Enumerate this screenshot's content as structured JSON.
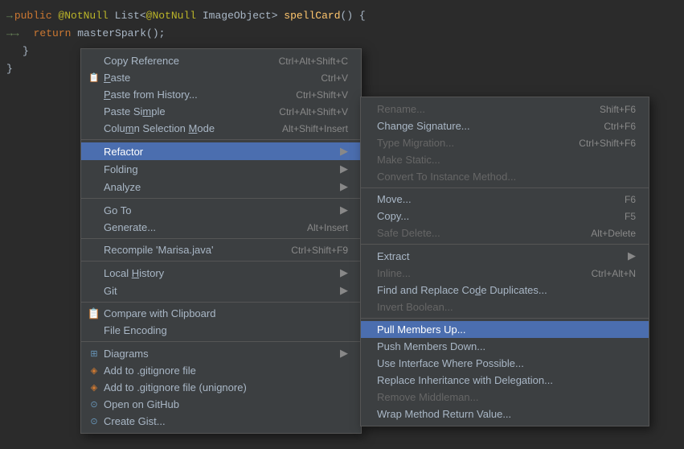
{
  "code": {
    "lines": [
      {
        "id": "line1",
        "arrow": "→",
        "content": "public ",
        "annotation": "@NotNull",
        "rest": " List<",
        "ann2": "@NotNull",
        "rest2": " ImageObject> ",
        "fn": "spellCard",
        "end": "() {"
      },
      {
        "id": "line2",
        "arrow": "→→",
        "indent": true,
        "ret": "return ",
        "text": "masterSpark();"
      },
      {
        "id": "line3",
        "brace": "}"
      }
    ]
  },
  "leftMenu": {
    "items": [
      {
        "id": "copy-reference",
        "label": "Copy Reference",
        "shortcut": "Ctrl+Alt+Shift+C",
        "icon": "",
        "hasArrow": false
      },
      {
        "id": "paste",
        "label": "Paste",
        "shortcut": "Ctrl+V",
        "icon": "📋",
        "hasArrow": false
      },
      {
        "id": "paste-from-history",
        "label": "Paste from History...",
        "shortcut": "Ctrl+Shift+V",
        "icon": "",
        "hasArrow": false
      },
      {
        "id": "paste-simple",
        "label": "Paste Simple",
        "shortcut": "Ctrl+Alt+Shift+V",
        "icon": "",
        "hasArrow": false
      },
      {
        "id": "column-selection",
        "label": "Column Selection Mode",
        "shortcut": "Alt+Shift+Insert",
        "icon": "",
        "hasArrow": false
      },
      {
        "id": "separator1",
        "type": "separator"
      },
      {
        "id": "refactor",
        "label": "Refactor",
        "shortcut": "",
        "icon": "",
        "hasArrow": true,
        "active": true
      },
      {
        "id": "folding",
        "label": "Folding",
        "shortcut": "",
        "icon": "",
        "hasArrow": true
      },
      {
        "id": "analyze",
        "label": "Analyze",
        "shortcut": "",
        "icon": "",
        "hasArrow": true
      },
      {
        "id": "separator2",
        "type": "separator"
      },
      {
        "id": "goto",
        "label": "Go To",
        "shortcut": "",
        "icon": "",
        "hasArrow": true
      },
      {
        "id": "generate",
        "label": "Generate...",
        "shortcut": "Alt+Insert",
        "icon": "",
        "hasArrow": false
      },
      {
        "id": "separator3",
        "type": "separator"
      },
      {
        "id": "recompile",
        "label": "Recompile 'Marisa.java'",
        "shortcut": "Ctrl+Shift+F9",
        "icon": "",
        "hasArrow": false
      },
      {
        "id": "separator4",
        "type": "separator"
      },
      {
        "id": "local-history",
        "label": "Local History",
        "shortcut": "",
        "icon": "",
        "hasArrow": true
      },
      {
        "id": "git",
        "label": "Git",
        "shortcut": "",
        "icon": "",
        "hasArrow": true
      },
      {
        "id": "separator5",
        "type": "separator"
      },
      {
        "id": "compare-clipboard",
        "label": "Compare with Clipboard",
        "shortcut": "",
        "icon": "📋",
        "hasArrow": false
      },
      {
        "id": "file-encoding",
        "label": "File Encoding",
        "shortcut": "",
        "icon": "",
        "hasArrow": false
      },
      {
        "id": "separator6",
        "type": "separator"
      },
      {
        "id": "diagrams",
        "label": "Diagrams",
        "shortcut": "",
        "icon": "⊞",
        "hasArrow": true
      },
      {
        "id": "add-gitignore",
        "label": "Add to .gitignore file",
        "shortcut": "",
        "icon": "◈",
        "hasArrow": false
      },
      {
        "id": "add-gitignore-unignore",
        "label": "Add to .gitignore file (unignore)",
        "shortcut": "",
        "icon": "◈",
        "hasArrow": false
      },
      {
        "id": "open-github",
        "label": "Open on GitHub",
        "shortcut": "",
        "icon": "⊙",
        "hasArrow": false
      },
      {
        "id": "create-gist",
        "label": "Create Gist...",
        "shortcut": "",
        "icon": "⊙",
        "hasArrow": false
      }
    ]
  },
  "rightMenu": {
    "title": "Refactor",
    "items": [
      {
        "id": "rename",
        "label": "Rename...",
        "shortcut": "Shift+F6",
        "disabled": true
      },
      {
        "id": "change-sig",
        "label": "Change Signature...",
        "shortcut": "Ctrl+F6",
        "disabled": false
      },
      {
        "id": "type-migration",
        "label": "Type Migration...",
        "shortcut": "Ctrl+Shift+F6",
        "disabled": true
      },
      {
        "id": "make-static",
        "label": "Make Static...",
        "shortcut": "",
        "disabled": true
      },
      {
        "id": "convert-instance",
        "label": "Convert To Instance Method...",
        "shortcut": "",
        "disabled": true
      },
      {
        "id": "separator1",
        "type": "separator"
      },
      {
        "id": "move",
        "label": "Move...",
        "shortcut": "F6",
        "disabled": false
      },
      {
        "id": "copy",
        "label": "Copy...",
        "shortcut": "F5",
        "disabled": false
      },
      {
        "id": "safe-delete",
        "label": "Safe Delete...",
        "shortcut": "Alt+Delete",
        "disabled": true
      },
      {
        "id": "separator2",
        "type": "separator"
      },
      {
        "id": "extract",
        "label": "Extract",
        "shortcut": "",
        "disabled": false,
        "hasArrow": true
      },
      {
        "id": "inline",
        "label": "Inline...",
        "shortcut": "Ctrl+Alt+N",
        "disabled": true
      },
      {
        "id": "find-replace",
        "label": "Find and Replace Code Duplicates...",
        "shortcut": "",
        "disabled": false
      },
      {
        "id": "invert-boolean",
        "label": "Invert Boolean...",
        "shortcut": "",
        "disabled": true
      },
      {
        "id": "separator3",
        "type": "separator"
      },
      {
        "id": "pull-members-up",
        "label": "Pull Members Up...",
        "shortcut": "",
        "disabled": false,
        "active": true
      },
      {
        "id": "push-members-down",
        "label": "Push Members Down...",
        "shortcut": "",
        "disabled": false
      },
      {
        "id": "use-interface",
        "label": "Use Interface Where Possible...",
        "shortcut": "",
        "disabled": false
      },
      {
        "id": "replace-inheritance",
        "label": "Replace Inheritance with Delegation...",
        "shortcut": "",
        "disabled": false
      },
      {
        "id": "remove-middleman",
        "label": "Remove Middleman...",
        "shortcut": "",
        "disabled": true
      },
      {
        "id": "wrap-method",
        "label": "Wrap Method Return Value...",
        "shortcut": "",
        "disabled": false
      }
    ]
  }
}
